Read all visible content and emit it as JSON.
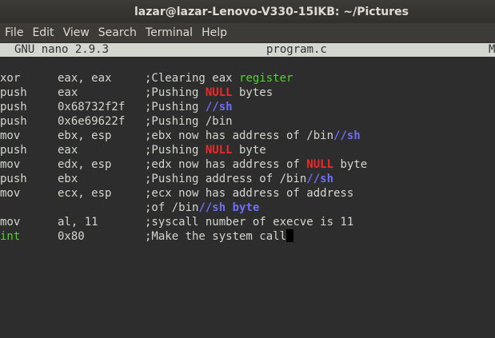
{
  "window": {
    "title": "lazar@lazar-Lenovo-V330-15IKB: ~/Pictures"
  },
  "menubar": {
    "items": [
      "File",
      "Edit",
      "View",
      "Search",
      "Terminal",
      "Help"
    ]
  },
  "nano": {
    "version": "GNU nano 2.9.3",
    "filename": "program.c",
    "status_flag": "M"
  },
  "code": [
    {
      "op": "xor",
      "args": "eax, eax",
      "comment": [
        {
          "t": ";Clearing eax "
        },
        {
          "t": "register",
          "c": "green"
        }
      ]
    },
    {
      "op": "push",
      "args": "eax",
      "comment": [
        {
          "t": ";Pushing "
        },
        {
          "t": "NULL",
          "c": "red"
        },
        {
          "t": " bytes"
        }
      ]
    },
    {
      "op": "push",
      "args": "0x68732f2f",
      "comment": [
        {
          "t": ";Pushing "
        },
        {
          "t": "//sh",
          "c": "blue"
        }
      ]
    },
    {
      "op": "push",
      "args": "0x6e69622f",
      "comment": [
        {
          "t": ";Pushing /bin"
        }
      ]
    },
    {
      "op": "mov",
      "args": "ebx, esp",
      "comment": [
        {
          "t": ";ebx now has address of /bin"
        },
        {
          "t": "//sh",
          "c": "blue"
        }
      ]
    },
    {
      "op": "push",
      "args": "eax",
      "comment": [
        {
          "t": ";Pushing "
        },
        {
          "t": "NULL",
          "c": "red"
        },
        {
          "t": " byte"
        }
      ]
    },
    {
      "op": "mov",
      "args": "edx, esp",
      "comment": [
        {
          "t": ";edx now has address of "
        },
        {
          "t": "NULL",
          "c": "red"
        },
        {
          "t": " byte"
        }
      ]
    },
    {
      "op": "push",
      "args": "ebx",
      "comment": [
        {
          "t": ";Pushing address of /bin"
        },
        {
          "t": "//sh",
          "c": "blue"
        }
      ]
    },
    {
      "op": "mov",
      "args": "ecx, esp",
      "comment": [
        {
          "t": ";ecx now has address of address"
        }
      ]
    },
    {
      "op": "",
      "args": "",
      "comment": [
        {
          "t": ";of /bin"
        },
        {
          "t": "//sh byte",
          "c": "blue"
        }
      ]
    },
    {
      "op": "mov",
      "args": "al, 11",
      "comment": [
        {
          "t": ";syscall number of execve is 11"
        }
      ]
    },
    {
      "op": "int",
      "op_color": "green",
      "args": "0x80",
      "comment": [
        {
          "t": ";Make the system call"
        }
      ],
      "cursor": true
    }
  ]
}
